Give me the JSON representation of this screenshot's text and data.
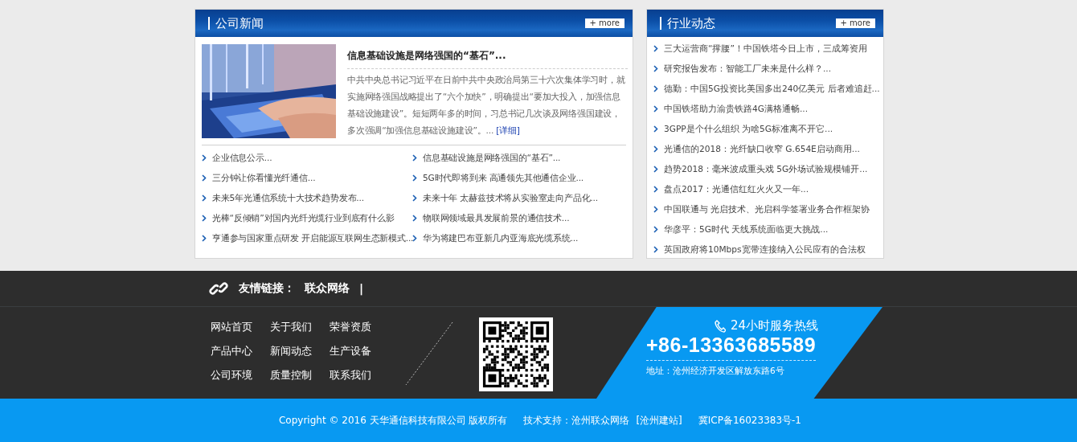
{
  "company_news": {
    "title": "公司新闻",
    "more": "+ more",
    "featured": {
      "kind": "picture",
      "title": "信息基础设施是网络强国的“基石”...",
      "summary": "中共中央总书记习近平在日前中共中央政治局第三十六次集体学习时，就实施网络强国战略提出了“六个加快”，明确提出“要加大投入，加强信息基础设施建设”。短短两年多的时间，习总书记几次谈及网络强国建设，多次强调“加强信息基础设施建设”。... ",
      "detail_link": "[详细]"
    },
    "items": [
      "企业信息公示...",
      "信息基础设施是网络强国的“基石”...",
      "三分钟让你看懂光纤通信...",
      "5G时代即将到来 高通领先其他通信企业...",
      "未来5年光通信系统十大技术趋势发布...",
      "未来十年 太赫兹技术将从实验室走向产品化...",
      "光棒“反倾销”对国内光纤光缆行业到底有什么影",
      "物联网领域最具发展前景的通信技术...",
      "亨通参与国家重点研发 开启能源互联网生态新模式...",
      "华为将建巴布亚新几内亚海底光缆系统..."
    ]
  },
  "industry_news": {
    "title": "行业动态",
    "more": "+ more",
    "items": [
      "三大运营商“撑腰”！中国铁塔今日上市，三成筹资用",
      "研究报告发布：智能工厂未来是什么样？...",
      "德勤：中国5G投资比美国多出240亿美元 后者难追赶...",
      "中国铁塔助力渝贵铁路4G满格通畅...",
      "3GPP是个什么组织 为啥5G标准离不开它...",
      "光通信的2018：光纤缺口收窄 G.654E启动商用...",
      "趋势2018：毫米波成重头戏 5G外场试验规模铺开...",
      "盘点2017：光通信红红火火又一年...",
      "中国联通与 光启技术、光启科学签署业务合作框架协",
      "华彦平：5G时代 天线系统面临更大挑战...",
      "英国政府将10Mbps宽带连接纳入公民应有的合法权"
    ]
  },
  "friend_links": {
    "label": "友情链接：",
    "links": [
      "联众网络"
    ],
    "separator": "|"
  },
  "footer_nav": [
    "网站首页",
    "关于我们",
    "荣誉资质",
    "产品中心",
    "新闻动态",
    "生产设备",
    "公司环境",
    "质量控制",
    "联系我们"
  ],
  "hotline": {
    "label": "24小时服务热线",
    "phone": "+86-13363685589",
    "address": "地址：沧州经济开发区解放东路6号"
  },
  "bottom_bar": {
    "copyright": "Copyright © 2016 天华通信科技有限公司 版权所有",
    "support": "技术支持：沧州联众网络",
    "support_link": "[沧州建站]",
    "icp": "冀ICP备16023383号-1"
  }
}
